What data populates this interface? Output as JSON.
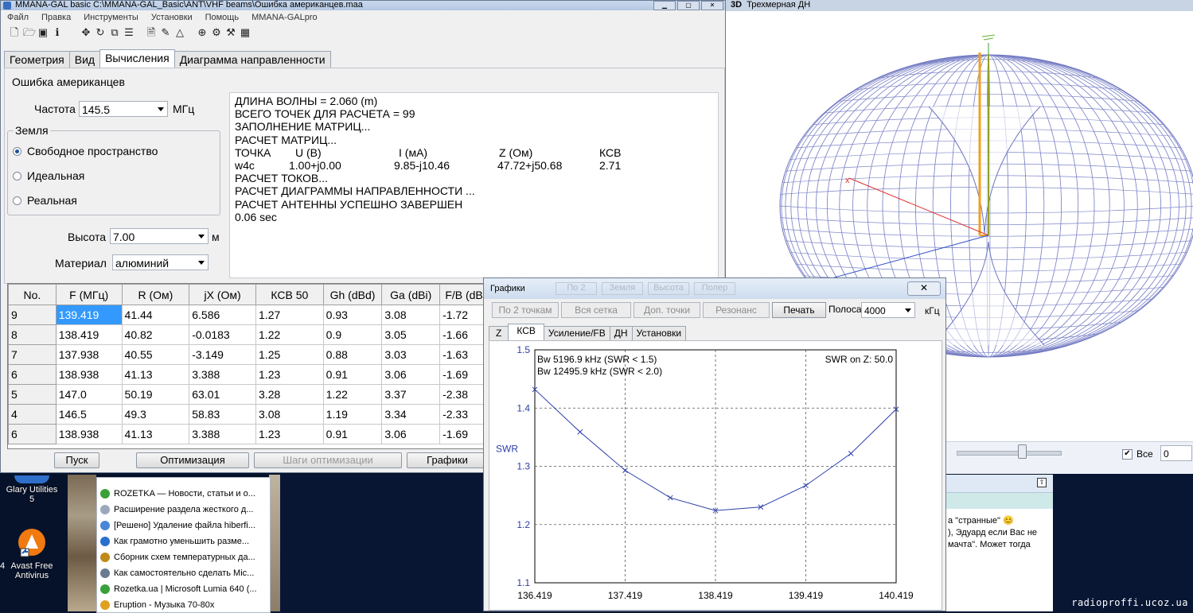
{
  "desktop": {
    "icons": [
      {
        "label": "Glary Utilities 5",
        "color": "#2f6fc9"
      },
      {
        "label": "Avast Free Antivirus",
        "color": "#f07a10"
      }
    ],
    "left_digit": "4",
    "watermark": "radioproffi.ucoz.ua"
  },
  "browser_tabs": [
    {
      "text": "ROZETKA — Новости, статьи и о...",
      "color": "#3aa039"
    },
    {
      "text": "Расширение раздела жесткого д...",
      "color": "#9aa8bc"
    },
    {
      "text": "[Решено] Удаление файла hiberfi...",
      "color": "#4a86d8"
    },
    {
      "text": "Как грамотно уменьшить разме...",
      "color": "#2a6fd0"
    },
    {
      "text": "Сборник схем температурных да...",
      "color": "#c08a1a"
    },
    {
      "text": "Как самостоятельно сделать Mic...",
      "color": "#6a7a90"
    },
    {
      "text": "Rozetka.ua | Microsoft Lumia 640 (...",
      "color": "#3aa039"
    },
    {
      "text": "Eruption - Музыка 70-80х",
      "color": "#e0a020"
    }
  ],
  "chat": {
    "lines": [
      "а \"странные\" 😊",
      "), Эдуард если Вас не",
      "мачта\". Может тогда"
    ]
  },
  "window3d": {
    "title": "Трехмерная ДН",
    "title_prefix": "3D",
    "all_label": "Все",
    "all_checked": true,
    "value": "0",
    "slider_position": 0.62
  },
  "main": {
    "title": "MMANA-GAL basic C:\\MMANA-GAL_Basic\\ANT\\VHF beams\\Ошибка американцев.maa",
    "menu": [
      "Файл",
      "Правка",
      "Инструменты",
      "Установки",
      "Помощь",
      "MMANA-GALpro"
    ],
    "tabs": [
      "Геометрия",
      "Вид",
      "Вычисления",
      "Диаграмма направленности"
    ],
    "active_tab": 2,
    "antenna_name": "Ошибка американцев",
    "freq_label": "Частота",
    "freq_value": "145.5",
    "freq_unit": "МГц",
    "ground_label": "Земля",
    "ground_options": [
      "Свободное пространство",
      "Идеальная",
      "Реальная"
    ],
    "ground_selected": 0,
    "height_label": "Высота",
    "height_value": "7.00",
    "height_unit": "м",
    "material_label": "Материал",
    "material_value": "алюминий",
    "log": {
      "lines": [
        "ДЛИНА ВОЛНЫ = 2.060 (m)",
        "ВСЕГО ТОЧЕК ДЛЯ РАСЧЕТА = 99",
        "ЗАПОЛНЕНИЕ МАТРИЦ...",
        "РАСЧЕТ МАТРИЦ..."
      ],
      "headers": [
        "ТОЧКА",
        "U (В)",
        "I (мА)",
        "Z (Ом)",
        "КСВ"
      ],
      "values": [
        "w4c",
        "1.00+j0.00",
        "9.85-j10.46",
        "47.72+j50.68",
        "2.71"
      ],
      "lines2": [
        "РАСЧЕТ ТОКОВ...",
        "РАСЧЕТ ДИАГРАММЫ НАПРАВЛЕННОСТИ ...",
        "РАСЧЕТ АНТЕННЫ УСПЕШНО ЗАВЕРШЕН",
        "0.06 sec"
      ]
    },
    "table": {
      "columns": [
        "No.",
        "F (МГц)",
        "R (Ом)",
        "jX (Ом)",
        "КСВ 50",
        "Gh (dBd)",
        "Ga (dBi)",
        "F/B (dB"
      ],
      "rows": [
        [
          "9",
          "139.419",
          "41.44",
          "6.586",
          "1.27",
          "0.93",
          "3.08",
          "-1.72"
        ],
        [
          "8",
          "138.419",
          "40.82",
          "-0.0183",
          "1.22",
          "0.9",
          "3.05",
          "-1.66"
        ],
        [
          "7",
          "137.938",
          "40.55",
          "-3.149",
          "1.25",
          "0.88",
          "3.03",
          "-1.63"
        ],
        [
          "6",
          "138.938",
          "41.13",
          "3.388",
          "1.23",
          "0.91",
          "3.06",
          "-1.69"
        ],
        [
          "5",
          "147.0",
          "50.19",
          "63.01",
          "3.28",
          "1.22",
          "3.37",
          "-2.38"
        ],
        [
          "4",
          "146.5",
          "49.3",
          "58.83",
          "3.08",
          "1.19",
          "3.34",
          "-2.33"
        ],
        [
          "6",
          "138.938",
          "41.13",
          "3.388",
          "1.23",
          "0.91",
          "3.06",
          "-1.69"
        ]
      ]
    },
    "buttons": {
      "start": "Пуск",
      "optimize": "Оптимизация",
      "opt_steps": "Шаги оптимизации",
      "graphs": "Графики"
    }
  },
  "graphs": {
    "title": "Графики",
    "close": "✕",
    "buttons": [
      "По 2 точкам",
      "Вся сетка",
      "Доп. точки",
      "Резонанс",
      "Печать"
    ],
    "band_label": "Полоса",
    "band_value": "4000",
    "band_unit": "кГц",
    "tabs": [
      "Z",
      "КСВ",
      "Усиление/FB",
      "ДН",
      "Установки"
    ],
    "active_tab": 1,
    "ghost_buttons": [
      "По 2",
      "Земля",
      "Высота",
      "Полер"
    ]
  },
  "chart_data": {
    "type": "line",
    "ylabel": "SWR",
    "annotations": [
      "Bw 5196.9 kHz (SWR < 1.5)",
      "Bw 12495.9 kHz (SWR < 2.0)",
      "SWR on Z: 50.0"
    ],
    "x_ticks": [
      "136.419",
      "137.419",
      "138.419",
      "139.419",
      "140.419"
    ],
    "y_ticks": [
      "1.5",
      "1.4",
      "1.3",
      "1.2",
      "1.1"
    ],
    "xlim": [
      136.419,
      140.419
    ],
    "ylim": [
      1.1,
      1.5
    ],
    "color": "#2b3fa8",
    "x": [
      136.419,
      136.919,
      137.419,
      137.919,
      138.419,
      138.919,
      139.419,
      139.919,
      140.419
    ],
    "y": [
      1.432,
      1.359,
      1.293,
      1.246,
      1.224,
      1.23,
      1.267,
      1.322,
      1.398
    ],
    "grid": true
  }
}
